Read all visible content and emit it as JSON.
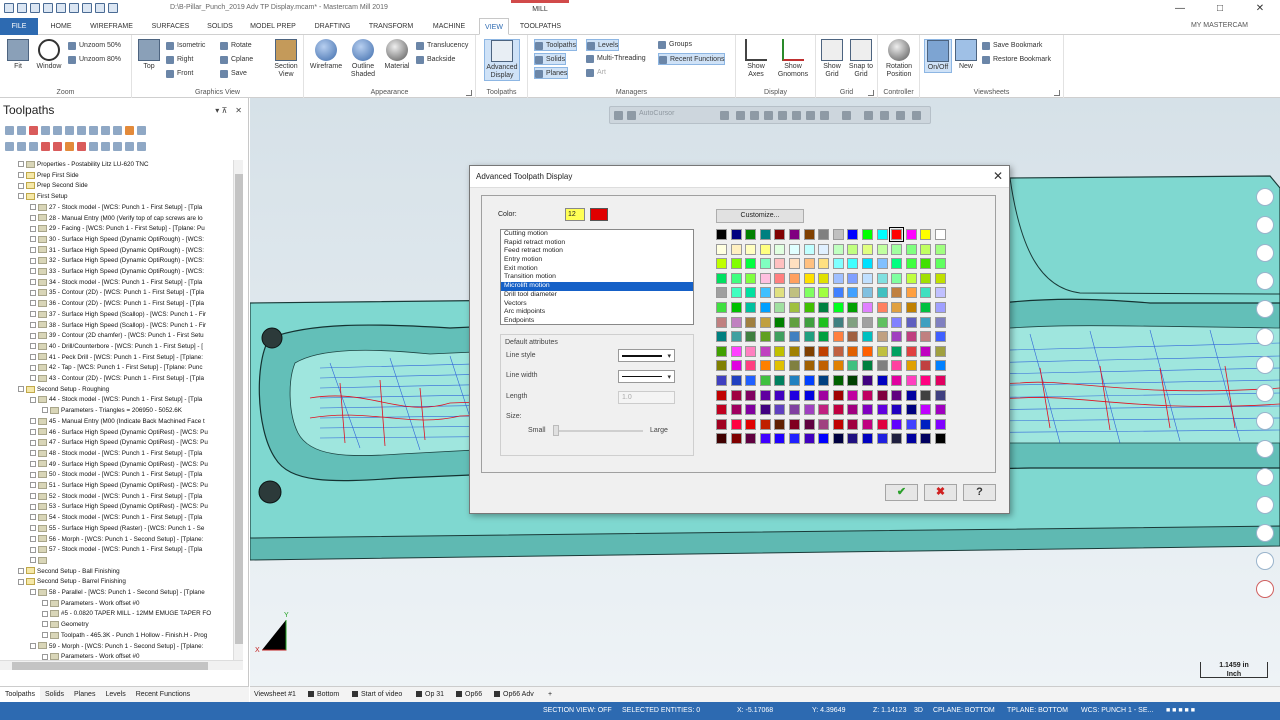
{
  "window": {
    "title": "D:\\B-Pillar_Punch_2019 Adv TP Display.mcam* - Mastercam Mill 2019",
    "context_tab": "MILL",
    "my_mastercam": "MY MASTERCAM",
    "minimize": "—",
    "maximize": "□",
    "close": "✕"
  },
  "ribbon_tabs": [
    "FILE",
    "HOME",
    "WIREFRAME",
    "SURFACES",
    "SOLIDS",
    "MODEL PREP",
    "DRAFTING",
    "TRANSFORM",
    "MACHINE",
    "VIEW",
    "TOOLPATHS"
  ],
  "ribbon": {
    "zoom": {
      "label": "Zoom",
      "fit": "Fit",
      "window": "Window",
      "unzoom50": "Unzoom 50%",
      "unzoom80": "Unzoom 80%"
    },
    "graphics_view": {
      "label": "Graphics View",
      "top": "Top",
      "isometric": "Isometric",
      "right": "Right",
      "front": "Front",
      "rotate": "Rotate",
      "cplane": "Cplane",
      "save": "Save",
      "section_view": "Section View"
    },
    "appearance": {
      "label": "Appearance",
      "wireframe": "Wireframe",
      "outline_shaded": "Outline Shaded",
      "material": "Material",
      "translucency": "Translucency",
      "backside": "Backside"
    },
    "toolpaths": {
      "label": "Toolpaths",
      "advanced_display": "Advanced Display"
    },
    "managers": {
      "label": "Managers",
      "toolpaths": "Toolpaths",
      "solids": "Solids",
      "planes": "Planes",
      "levels": "Levels",
      "multi_threading": "Multi-Threading",
      "art": "Art",
      "groups": "Groups",
      "recent_functions": "Recent Functions"
    },
    "display": {
      "label": "Display",
      "show_axes": "Show Axes",
      "show_gnomons": "Show Gnomons"
    },
    "grid": {
      "label": "Grid",
      "show_grid": "Show Grid",
      "snap_to_grid": "Snap to Grid"
    },
    "controller": {
      "label": "Controller",
      "rotation_position": "Rotation Position"
    },
    "viewsheets": {
      "label": "Viewsheets",
      "on_off": "On/Off",
      "new": "New",
      "save_bookmark": "Save Bookmark",
      "restore_bookmark": "Restore Bookmark"
    }
  },
  "left_panel": {
    "title": "Toolpaths",
    "pin": "▾  ⊼",
    "close": "✕",
    "tree": [
      {
        "text": "Properties - Postability Litz LU-620 TNC",
        "indent": 0,
        "folder": false
      },
      {
        "text": "Prep First Side",
        "indent": 0,
        "folder": true
      },
      {
        "text": "Prep Second Side",
        "indent": 0,
        "folder": true
      },
      {
        "text": "First Setup",
        "indent": 0,
        "folder": true
      },
      {
        "text": "27 - Stock model - [WCS: Punch 1 - First Setup] - [Tpla",
        "indent": 1,
        "folder": false
      },
      {
        "text": "28 - Manual Entry (M00 (Verify top of cap screws are lo",
        "indent": 1,
        "folder": false
      },
      {
        "text": "29 - Facing - [WCS: Punch 1 - First Setup] - [Tplane: Pu",
        "indent": 1,
        "folder": false
      },
      {
        "text": "30 - Surface High Speed (Dynamic OptiRough) - [WCS:",
        "indent": 1,
        "folder": false
      },
      {
        "text": "31 - Surface High Speed (Dynamic OptiRough) - [WCS:",
        "indent": 1,
        "folder": false
      },
      {
        "text": "32 - Surface High Speed (Dynamic OptiRough) - [WCS:",
        "indent": 1,
        "folder": false
      },
      {
        "text": "33 - Surface High Speed (Dynamic OptiRough) - [WCS:",
        "indent": 1,
        "folder": false
      },
      {
        "text": "34 - Stock model - [WCS: Punch 1 - First Setup] - [Tpla",
        "indent": 1,
        "folder": false
      },
      {
        "text": "35 - Contour (2D) - [WCS: Punch 1 - First Setup] - [Tpla",
        "indent": 1,
        "folder": false
      },
      {
        "text": "36 - Contour (2D) - [WCS: Punch 1 - First Setup] - [Tpla",
        "indent": 1,
        "folder": false
      },
      {
        "text": "37 - Surface High Speed (Scallop) - [WCS: Punch 1 - Fir",
        "indent": 1,
        "folder": false
      },
      {
        "text": "38 - Surface High Speed (Scallop) - [WCS: Punch 1 - Fir",
        "indent": 1,
        "folder": false
      },
      {
        "text": "39 - Contour (2D chamfer) - [WCS: Punch 1 - First Setu",
        "indent": 1,
        "folder": false
      },
      {
        "text": "40 - Drill/Counterbore - [WCS: Punch 1 - First Setup] - [",
        "indent": 1,
        "folder": false
      },
      {
        "text": "41 - Peck Drill - [WCS: Punch 1 - First Setup] - [Tplane:",
        "indent": 1,
        "folder": false
      },
      {
        "text": "42 - Tap - [WCS: Punch 1 - First Setup] - [Tplane: Punc",
        "indent": 1,
        "folder": false
      },
      {
        "text": "43 - Contour (2D) - [WCS: Punch 1 - First Setup] - [Tpla",
        "indent": 1,
        "folder": false
      },
      {
        "text": "Second Setup - Roughing",
        "indent": 0,
        "folder": true
      },
      {
        "text": "44 - Stock model - [WCS: Punch 1 - First Setup] - [Tpla",
        "indent": 1,
        "folder": false
      },
      {
        "text": "Parameters - Triangles = 206950 - 5052.6K",
        "indent": 2,
        "folder": false
      },
      {
        "text": "45 - Manual Entry (M00 (Indicate Back Machined Face t",
        "indent": 1,
        "folder": false
      },
      {
        "text": "46 - Surface High Speed (Dynamic OptiRest) - [WCS: Pu",
        "indent": 1,
        "folder": false
      },
      {
        "text": "47 - Surface High Speed (Dynamic OptiRest) - [WCS: Pu",
        "indent": 1,
        "folder": false
      },
      {
        "text": "48 - Stock model - [WCS: Punch 1 - First Setup] - [Tpla",
        "indent": 1,
        "folder": false
      },
      {
        "text": "49 - Surface High Speed (Dynamic OptiRest) - [WCS: Pu",
        "indent": 1,
        "folder": false
      },
      {
        "text": "50 - Stock model - [WCS: Punch 1 - First Setup] - [Tpla",
        "indent": 1,
        "folder": false
      },
      {
        "text": "51 - Surface High Speed (Dynamic OptiRest) - [WCS: Pu",
        "indent": 1,
        "folder": false
      },
      {
        "text": "52 - Stock model - [WCS: Punch 1 - First Setup] - [Tpla",
        "indent": 1,
        "folder": false
      },
      {
        "text": "53 - Surface High Speed (Dynamic OptiRest) - [WCS: Pu",
        "indent": 1,
        "folder": false
      },
      {
        "text": "54 - Stock model - [WCS: Punch 1 - First Setup] - [Tpla",
        "indent": 1,
        "folder": false
      },
      {
        "text": "55 - Surface High Speed (Raster) - [WCS: Punch 1 - Se",
        "indent": 1,
        "folder": false
      },
      {
        "text": "56 - Morph - [WCS: Punch 1 - Second Setup] - [Tplane:",
        "indent": 1,
        "folder": false
      },
      {
        "text": "57 - Stock model - [WCS: Punch 1 - First Setup] - [Tpla",
        "indent": 1,
        "folder": false
      },
      {
        "text": "",
        "indent": 1,
        "folder": false
      },
      {
        "text": "Second Setup - Ball Finishing",
        "indent": 0,
        "folder": true
      },
      {
        "text": "Second Setup - Barrel Finishing",
        "indent": 0,
        "folder": true
      },
      {
        "text": "58 - Parallel - [WCS: Punch 1 - Second Setup] - [Tplane",
        "indent": 1,
        "folder": false
      },
      {
        "text": "Parameters - Work offset #0",
        "indent": 2,
        "folder": false
      },
      {
        "text": "#5 - 0.0820 TAPER MILL - 12MM EMUGE TAPER FO",
        "indent": 2,
        "folder": false
      },
      {
        "text": "Geometry",
        "indent": 2,
        "folder": false
      },
      {
        "text": "Toolpath - 465.3K - Punch 1 Hollow - Finish.H - Prog",
        "indent": 2,
        "folder": false
      },
      {
        "text": "59 - Morph - [WCS: Punch 1 - Second Setup] - [Tplane:",
        "indent": 1,
        "folder": false
      },
      {
        "text": "Parameters - Work offset #0",
        "indent": 2,
        "folder": false
      }
    ],
    "tabs": [
      "Toolpaths",
      "Solids",
      "Planes",
      "Levels",
      "Recent Functions"
    ]
  },
  "viewport": {
    "autocursor": "AutoCursor",
    "scale": "1.1459 in",
    "scale_unit": "Inch",
    "axis_x": "X",
    "axis_y": "Y",
    "tabs": [
      "Viewsheet #1",
      "Bottom",
      "Start of video",
      "Op 31",
      "Op66",
      "Op66 Adv"
    ],
    "add_tab": "+"
  },
  "status_bar": {
    "section_view": "SECTION VIEW: OFF",
    "selected": "SELECTED ENTITIES: 0",
    "x": "X:  -5.17068",
    "y": "Y:  4.39649",
    "z": "Z:  1.14123",
    "mode": "3D",
    "cplane": "CPLANE: BOTTOM",
    "tplane": "TPLANE: BOTTOM",
    "wcs": "WCS: PUNCH 1 - SE..."
  },
  "dialog": {
    "title": "Advanced Toolpath Display",
    "close": "✕",
    "color_label": "Color:",
    "color_number": "12",
    "selected_color": "#e00000",
    "customize": "Customize...",
    "motion_types": [
      "Cutting motion",
      "Rapid retract motion",
      "Feed retract motion",
      "Entry motion",
      "Exit motion",
      "Transition motion",
      "Microlift motion",
      "Drill tool diameter",
      "Vectors",
      "Arc midpoints",
      "Endpoints"
    ],
    "selected_motion": "Microlift motion",
    "default_attributes": "Default attributes",
    "line_style": "Line style",
    "line_width": "Line width",
    "length": "Length",
    "length_value": "1.0",
    "size": "Size:",
    "small": "Small",
    "large": "Large",
    "ok": "✔",
    "cancel": "✖",
    "help": "?",
    "palette": [
      "#000000",
      "#000080",
      "#008000",
      "#008080",
      "#800000",
      "#800080",
      "#804000",
      "#808080",
      "#c0c0c0",
      "#0000ff",
      "#00ff00",
      "#00ffff",
      "#ff0000",
      "#ff00ff",
      "#ffff00",
      "#ffffff",
      "#ffffe0",
      "#fff0c0",
      "#ffffc0",
      "#ffff80",
      "#e0ffe0",
      "#e0ffff",
      "#c0ffff",
      "#e0f0ff",
      "#c0ffc0",
      "#c0ff80",
      "#e0ff80",
      "#c0ffa0",
      "#a0ffa0",
      "#80ff80",
      "#c0ff60",
      "#a0ff80",
      "#c0ff00",
      "#80ff00",
      "#00ff40",
      "#80ffc0",
      "#ffc0c0",
      "#ffe0c0",
      "#ffc080",
      "#ffe080",
      "#80ffff",
      "#40ffff",
      "#00e0ff",
      "#80c0ff",
      "#00ff80",
      "#40ff40",
      "#40e000",
      "#60ff60",
      "#00e060",
      "#40ff80",
      "#80ff40",
      "#ffc0e0",
      "#ff8080",
      "#ffa060",
      "#ffe000",
      "#e0e000",
      "#a0c0ff",
      "#80a0ff",
      "#c0e0ff",
      "#80e0e0",
      "#80ffa0",
      "#c0ff40",
      "#a0e000",
      "#c0e000",
      "#a0a0a0",
      "#40ffc0",
      "#00e0a0",
      "#40c0ff",
      "#e0e080",
      "#c0c080",
      "#80ff60",
      "#a0ff40",
      "#4080ff",
      "#40a0ff",
      "#80c0e0",
      "#40c0c0",
      "#c08040",
      "#ffa040",
      "#40e0c0",
      "#c0c0ff",
      "#40e040",
      "#00c000",
      "#00c0a0",
      "#00a0ff",
      "#a0e0a0",
      "#a0c040",
      "#40c000",
      "#008040",
      "#00ff20",
      "#00a000",
      "#e080ff",
      "#ff8060",
      "#e0a040",
      "#c08000",
      "#00c040",
      "#a0a0ff",
      "#c08080",
      "#c080c0",
      "#a08040",
      "#c0a040",
      "#008000",
      "#60a040",
      "#40a040",
      "#20c020",
      "#408080",
      "#80a080",
      "#a0a0a0",
      "#60c060",
      "#8080ff",
      "#6060c0",
      "#40a0c0",
      "#8080c0",
      "#008080",
      "#40a0a0",
      "#408040",
      "#60a020",
      "#40a060",
      "#4080c0",
      "#20a080",
      "#00a040",
      "#ff8040",
      "#a06040",
      "#00c0c0",
      "#c0a080",
      "#a040c0",
      "#c04080",
      "#c08080",
      "#4060ff",
      "#40a000",
      "#ff40ff",
      "#ff80c0",
      "#c040c0",
      "#c0c000",
      "#a08000",
      "#804000",
      "#c04000",
      "#c06040",
      "#e06000",
      "#ff6000",
      "#c0c040",
      "#00a060",
      "#e04040",
      "#c000c0",
      "#a0a040",
      "#808000",
      "#e000e0",
      "#ff4080",
      "#ff8000",
      "#e0c000",
      "#808040",
      "#a06000",
      "#c06000",
      "#e08000",
      "#40c080",
      "#008040",
      "#808080",
      "#ff40a0",
      "#e0a000",
      "#c04040",
      "#0080ff",
      "#4040c0",
      "#2040c0",
      "#2060ff",
      "#40c040",
      "#008060",
      "#2080c0",
      "#0040ff",
      "#004080",
      "#006000",
      "#004000",
      "#400080",
      "#0000c0",
      "#e000a0",
      "#ff40c0",
      "#ff0080",
      "#e00060",
      "#c00000",
      "#a00040",
      "#800060",
      "#6000a0",
      "#4000c0",
      "#2000e0",
      "#0000e0",
      "#a000a0",
      "#a00000",
      "#c000a0",
      "#c00060",
      "#800040",
      "#600080",
      "#0000a0",
      "#404040",
      "#404080",
      "#c00020",
      "#a00060",
      "#8000a0",
      "#400080",
      "#6040c0",
      "#8040a0",
      "#a040c0",
      "#c02080",
      "#c00040",
      "#a00080",
      "#8000c0",
      "#6000e0",
      "#2000c0",
      "#000080",
      "#c000ff",
      "#a000c0",
      "#a00020",
      "#ff0040",
      "#e00000",
      "#c02000",
      "#602000",
      "#800020",
      "#600040",
      "#a04080",
      "#c00000",
      "#a00040",
      "#c00080",
      "#e00040",
      "#6000ff",
      "#4040ff",
      "#0020c0",
      "#8000ff",
      "#400000",
      "#800000",
      "#600040",
      "#4000ff",
      "#2000ff",
      "#2020ff",
      "#4000c0",
      "#0000ff",
      "#000040",
      "#201080",
      "#0000c0",
      "#2020e0",
      "#202040",
      "#0000a0",
      "#000060",
      "#000000"
    ]
  }
}
